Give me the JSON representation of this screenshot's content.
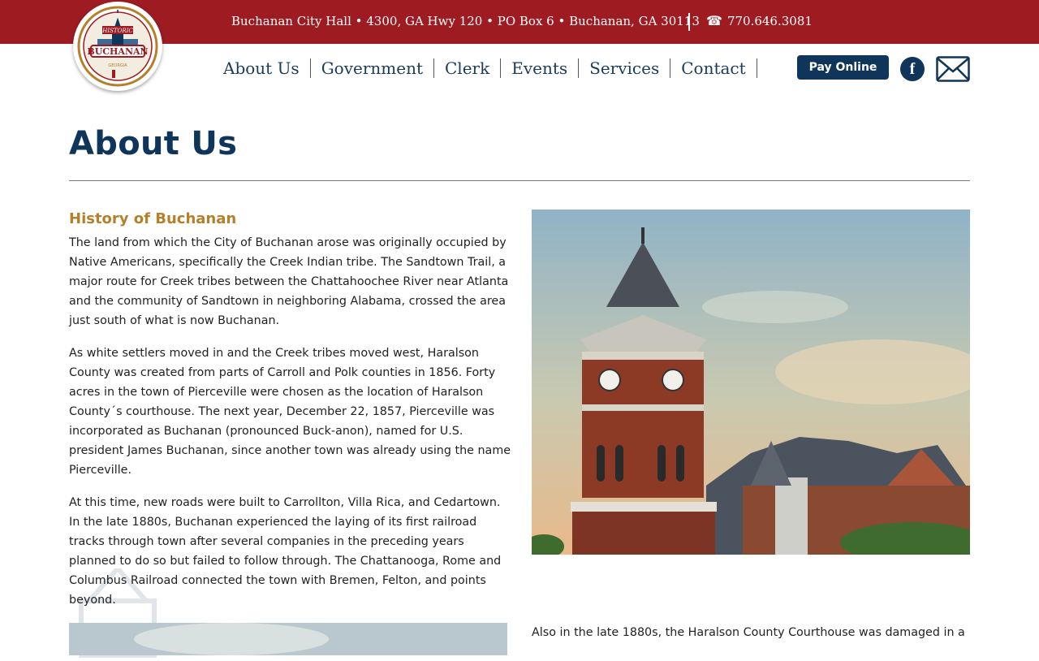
{
  "header": {
    "address": "Buchanan City Hall • 4300, GA Hwy 120 • PO Box 6 • Buchanan, GA 30113",
    "phone": "770.646.3081",
    "phone_icon": "phone-icon"
  },
  "logo": {
    "text_top": "HISTORIC",
    "text_main": "BUCHANAN",
    "text_bottom": "GEORGIA"
  },
  "nav": {
    "items": [
      {
        "label": "About Us"
      },
      {
        "label": "Government"
      },
      {
        "label": "Clerk"
      },
      {
        "label": "Events"
      },
      {
        "label": "Services"
      },
      {
        "label": "Contact"
      }
    ]
  },
  "actions": {
    "pay_label": "Pay Online",
    "facebook_icon": "facebook-icon",
    "mail_icon": "mail-icon"
  },
  "page": {
    "title": "About Us",
    "section_title": "History of Buchanan",
    "paragraphs": [
      "The land from which the City of Buchanan arose was originally occupied by Native Americans, specifically the Creek Indian tribe. The Sandtown Trail, a major route for Creek tribes between the Chattahoochee River near Atlanta and the community of Sandtown in neighboring Alabama, crossed the area just south of what is now Buchanan.",
      "As white settlers moved in and the Creek tribes moved west, Haralson County was created from parts of Carroll and Polk counties in 1856. Forty acres in the town of Pierceville were chosen as the location of Haralson County´s courthouse. The next year, December 22, 1857, Pierceville was incorporated as Buchanan (pronounced Buck-anon), named for U.S. president James Buchanan, since another town was already using the name Pierceville.",
      "At this time, new roads were built to Carrollton, Villa Rica, and Cedartown. In the late 1880s, Buchanan experienced the laying of its first railroad tracks through town after several companies in the preceding years planned to do so but failed to follow through. The Chattanooga, Rome and Columbus Railroad connected the town with Bremen, Felton, and points beyond."
    ],
    "bottom_text": "Also in the late 1880s, the Haralson County Courthouse was damaged in a"
  },
  "colors": {
    "header_red": "#9e1b22",
    "navy": "#10355a",
    "gold": "#b5802a"
  }
}
